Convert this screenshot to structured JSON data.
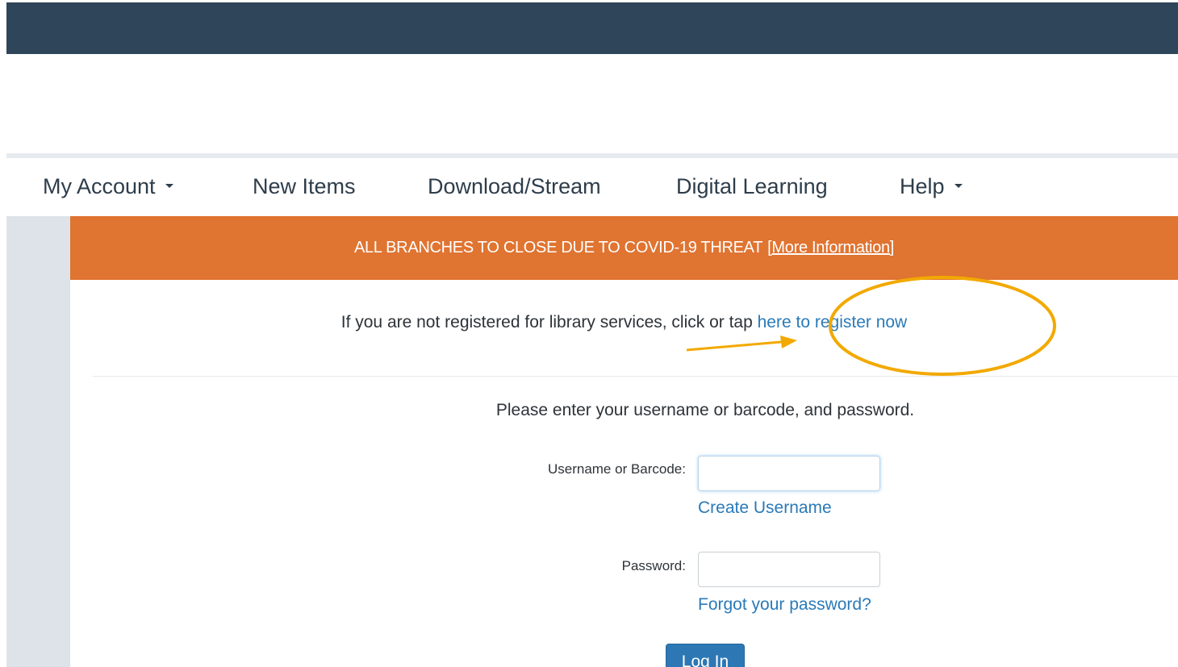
{
  "nav": {
    "items": [
      {
        "label": "My Account",
        "dropdown": true
      },
      {
        "label": "New Items",
        "dropdown": false
      },
      {
        "label": "Download/Stream",
        "dropdown": false
      },
      {
        "label": "Digital Learning",
        "dropdown": false
      },
      {
        "label": "Help",
        "dropdown": true
      }
    ]
  },
  "banner": {
    "text": "ALL BRANCHES TO CLOSE DUE TO COVID-19 THREAT",
    "link": "[More Information]"
  },
  "register": {
    "prefix": "If you are not registered for library services, click or tap ",
    "link": "here to register now"
  },
  "login": {
    "instructions": "Please enter your username or barcode, and password.",
    "username_label": "Username or Barcode:",
    "username_value": "",
    "create_username": "Create Username",
    "password_label": "Password:",
    "password_value": "",
    "forgot_password": "Forgot your password?",
    "submit": "Log In"
  },
  "colors": {
    "header": "#2f4559",
    "banner": "#e07431",
    "link": "#2a7ab8",
    "button": "#2d78b4",
    "annotation": "#f2a900"
  }
}
